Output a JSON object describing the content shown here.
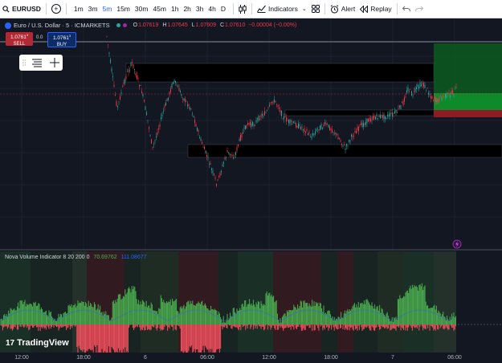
{
  "toolbar": {
    "symbol": "EURUSD",
    "timeframes": [
      "1m",
      "3m",
      "5m",
      "15m",
      "30m",
      "45m",
      "1h",
      "2h",
      "3h",
      "4h",
      "D"
    ],
    "active_timeframe": "5m",
    "indicators_label": "Indicators",
    "alert_label": "Alert",
    "replay_label": "Replay"
  },
  "legend": {
    "title": "Euro / U.S. Dollar · 5 · ICMARKETS",
    "o_label": "O",
    "o_value": "1.07619",
    "h_label": "H",
    "h_value": "1.07645",
    "l_label": "L",
    "l_value": "1.07609",
    "c_label": "C",
    "c_value": "1.07610",
    "change": "−0.00004 (−0.00%)"
  },
  "trade": {
    "sell_price": "1.0761",
    "sell_sup": "3",
    "sell_label": "SELL",
    "spread": "0.0",
    "buy_price": "1.0761",
    "buy_sup": "3",
    "buy_label": "BUY"
  },
  "indicator": {
    "name": "Nova Volume Indicator 8 20 200 0",
    "value1": "70.69762",
    "value2": "111.08677"
  },
  "branding": {
    "logo_text": "TradingView"
  },
  "xaxis": {
    "labels": [
      "12:00",
      "18:00",
      "6",
      "06:00",
      "12:00",
      "18:00",
      "7",
      "06:00"
    ]
  },
  "colors": {
    "up": "#26a69a",
    "down": "#f23645",
    "background": "#131722",
    "accent": "#2962ff",
    "vol_up": "#4caf50",
    "vol_down": "#f7525f",
    "vol_line": "#2962ff"
  },
  "icons": [
    "plus-circle-icon",
    "candles-icon",
    "indicators-icon",
    "layout-grid-icon",
    "alert-clock-icon",
    "replay-icon",
    "undo-icon",
    "redo-icon",
    "lightning-icon"
  ]
}
